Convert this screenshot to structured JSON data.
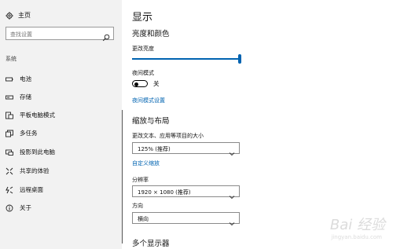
{
  "sidebar": {
    "home": {
      "label": "主页",
      "icon": "gear-icon"
    },
    "search": {
      "placeholder": "查找设置",
      "icon": "search-icon"
    },
    "section_label": "系统",
    "items": [
      {
        "label": "电池",
        "icon": "battery-icon"
      },
      {
        "label": "存储",
        "icon": "storage-icon"
      },
      {
        "label": "平板电脑模式",
        "icon": "tablet-mode-icon"
      },
      {
        "label": "多任务",
        "icon": "multitasking-icon"
      },
      {
        "label": "投影到此电脑",
        "icon": "projecting-icon"
      },
      {
        "label": "共享的体验",
        "icon": "shared-experiences-icon"
      },
      {
        "label": "远程桌面",
        "icon": "remote-desktop-icon"
      },
      {
        "label": "关于",
        "icon": "info-icon"
      }
    ]
  },
  "main": {
    "title": "显示",
    "brightness_section": {
      "heading": "亮度和颜色",
      "brightness_label": "更改亮度",
      "brightness_level": 1.0,
      "night_mode_label": "夜间模式",
      "night_mode_state": "关",
      "night_mode_settings_link": "夜间模式设置"
    },
    "scale_section": {
      "heading": "缩放与布局",
      "scale_label": "更改文本、应用等项目的大小",
      "scale_value": "125% (推荐)",
      "custom_scale_link": "自定义缩放",
      "resolution_label": "分辨率",
      "resolution_value": "1920 × 1080 (推荐)",
      "orientation_label": "方向",
      "orientation_value": "横向"
    },
    "multi_display_heading": "多个显示器"
  },
  "watermark": {
    "brand": "Bai 经验",
    "url": "jingyan.baidu.com"
  },
  "colors": {
    "accent": "#0063b1",
    "sidebar_bg": "#f2f2f2"
  }
}
